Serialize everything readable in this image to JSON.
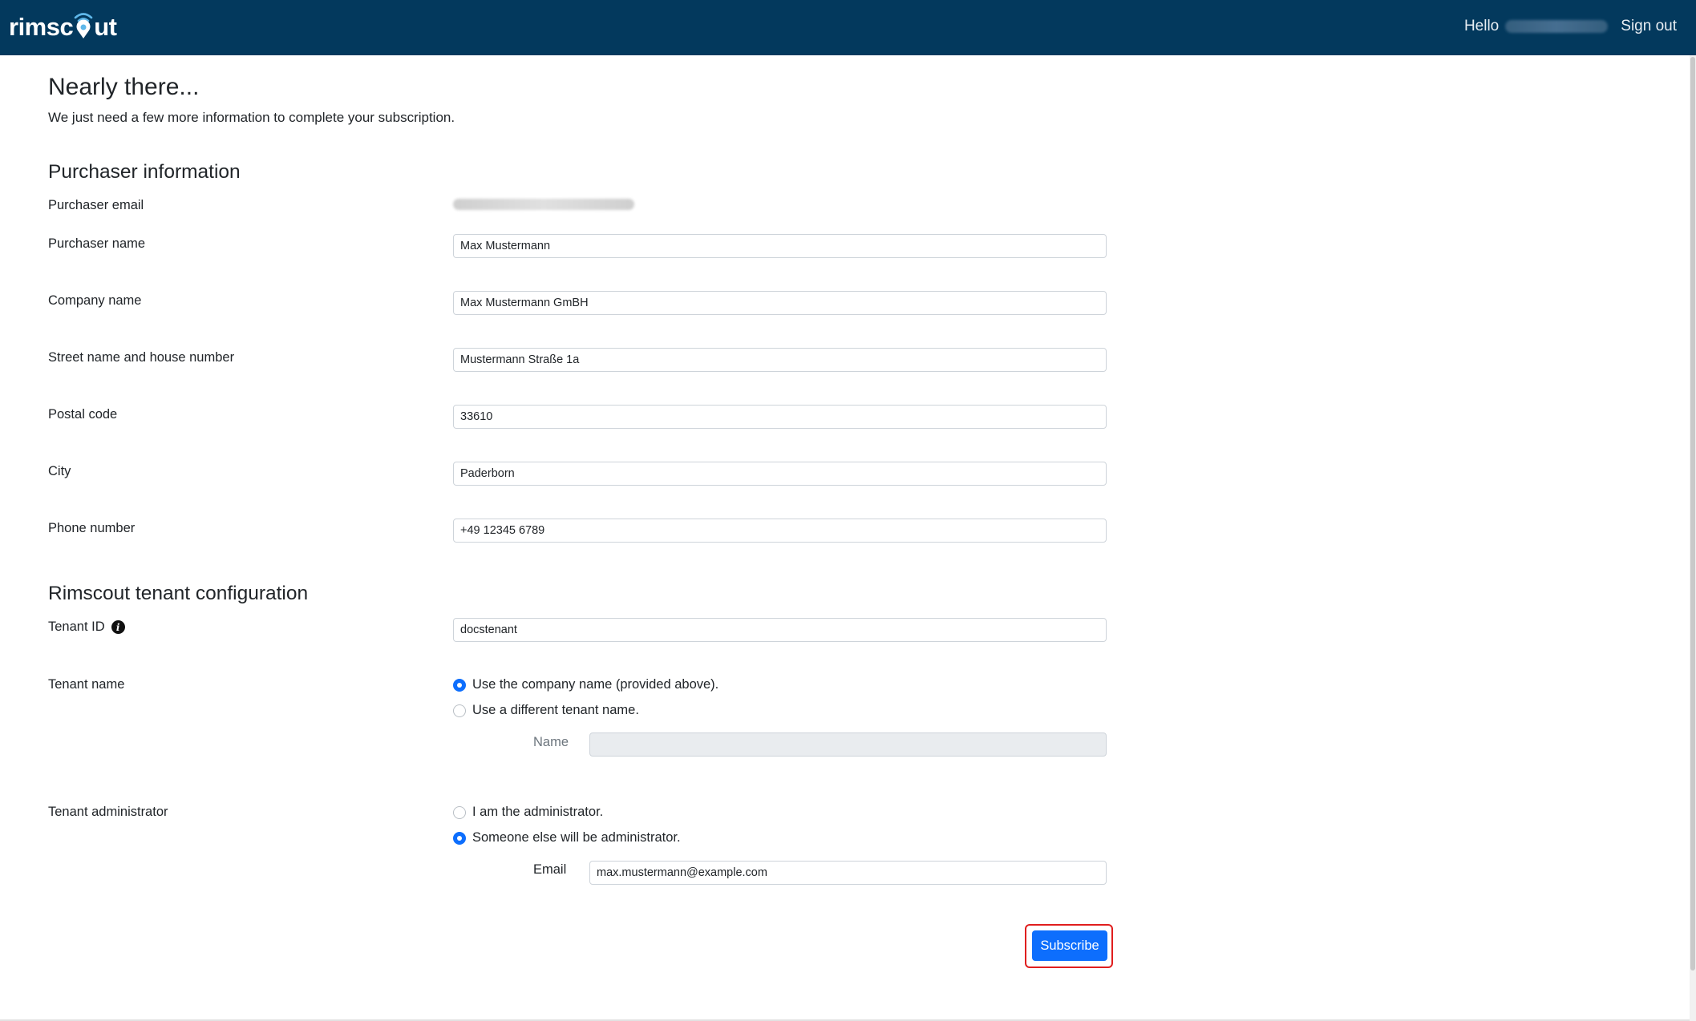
{
  "header": {
    "brand": {
      "pre": "rimsc",
      "post": "ut"
    },
    "greeting": "Hello",
    "signout_label": "Sign out"
  },
  "page": {
    "title": "Nearly there...",
    "subtitle": "We just need a few more information to complete your subscription."
  },
  "purchaser": {
    "heading": "Purchaser information",
    "email_label": "Purchaser email",
    "name_label": "Purchaser name",
    "name_value": "Max Mustermann",
    "company_label": "Company name",
    "company_value": "Max Mustermann GmBH",
    "street_label": "Street name and house number",
    "street_value": "Mustermann Straße 1a",
    "postal_label": "Postal code",
    "postal_value": "33610",
    "city_label": "City",
    "city_value": "Paderborn",
    "phone_label": "Phone number",
    "phone_value": "+49 12345 6789"
  },
  "tenant": {
    "heading": "Rimscout tenant configuration",
    "id_label": "Tenant ID",
    "id_value": "docstenant",
    "name_label": "Tenant name",
    "name_option_company": "Use the company name (provided above).",
    "name_option_different": "Use a different tenant name.",
    "name_sub_label": "Name",
    "name_sub_value": "",
    "admin_label": "Tenant administrator",
    "admin_option_self": "I am the administrator.",
    "admin_option_other": "Someone else will be administrator.",
    "admin_email_label": "Email",
    "admin_email_value": "max.mustermann@example.com"
  },
  "actions": {
    "subscribe_label": "Subscribe"
  },
  "colors": {
    "navbar": "#03395d",
    "primary": "#0d6efd",
    "highlight": "#e01e1e"
  }
}
